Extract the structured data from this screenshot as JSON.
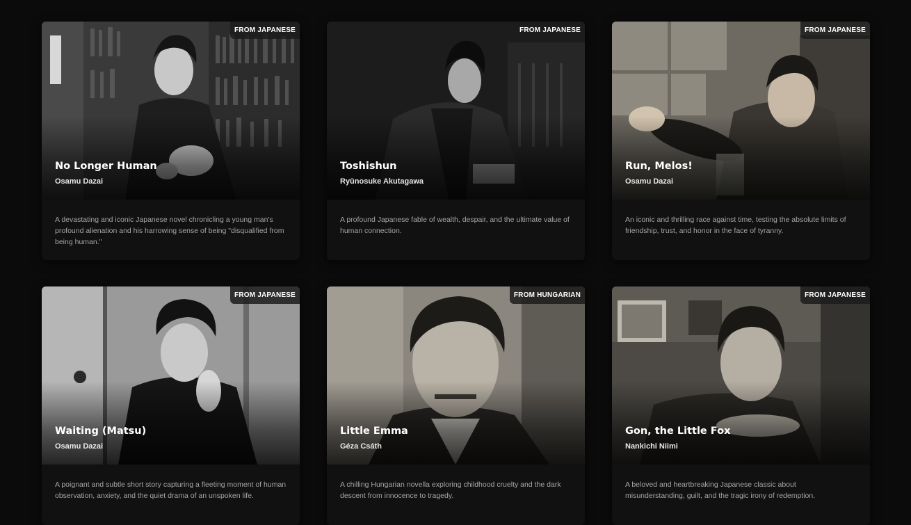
{
  "books": [
    {
      "language_badge": "FROM JAPANESE",
      "title": "No Longer Human",
      "author": "Osamu Dazai",
      "description": "A devastating and iconic Japanese novel chronicling a young man's profound alienation and his harrowing sense of being \"disqualified from being human.\""
    },
    {
      "language_badge": "FROM JAPANESE",
      "title": "Toshishun",
      "author": "Ryūnosuke Akutagawa",
      "description": "A profound Japanese fable of wealth, despair, and the ultimate value of human connection."
    },
    {
      "language_badge": "FROM JAPANESE",
      "title": "Run, Melos!",
      "author": "Osamu Dazai",
      "description": "An iconic and thrilling race against time, testing the absolute limits of friendship, trust, and honor in the face of tyranny."
    },
    {
      "language_badge": "FROM JAPANESE",
      "title": "Waiting (Matsu)",
      "author": "Osamu Dazai",
      "description": "A poignant and subtle short story capturing a fleeting moment of human observation, anxiety, and the quiet drama of an unspoken life."
    },
    {
      "language_badge": "FROM HUNGARIAN",
      "title": "Little Emma",
      "author": "Géza Csáth",
      "description": "A chilling Hungarian novella exploring childhood cruelty and the dark descent from innocence to tragedy."
    },
    {
      "language_badge": "FROM JAPANESE",
      "title": "Gon, the Little Fox",
      "author": "Nankichi Niimi",
      "description": "A beloved and heartbreaking Japanese classic about misunderstanding, guilt, and the tragic irony of redemption."
    }
  ]
}
